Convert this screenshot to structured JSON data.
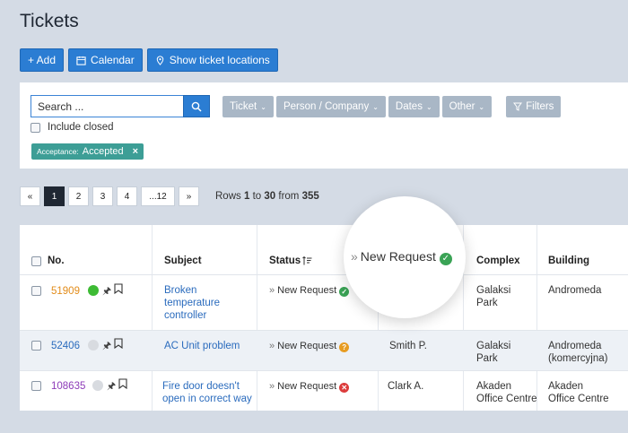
{
  "page": {
    "title": "Tickets"
  },
  "toolbar": {
    "add_label": "+ Add",
    "calendar_label": "Calendar",
    "locations_label": "Show ticket locations"
  },
  "filters": {
    "search_placeholder": "Search ...",
    "include_closed_label": "Include closed",
    "buttons": [
      "Ticket",
      "Person / Company",
      "Dates",
      "Other"
    ],
    "filters_label": "Filters",
    "tag_label": "Acceptance:",
    "tag_value": "Accepted",
    "tag_remove": "×"
  },
  "pagination": {
    "prev": "«",
    "pages": [
      "1",
      "2",
      "3",
      "4",
      "...12"
    ],
    "next": "»",
    "rows_prefix": "Rows",
    "rows_from": "1",
    "rows_to_word": "to",
    "rows_to": "30",
    "rows_from_word": "from",
    "rows_total": "355"
  },
  "table": {
    "headers": {
      "no": "No.",
      "subject": "Subject",
      "status": "Status",
      "complex": "Complex",
      "building": "Building"
    },
    "rows": [
      {
        "no": "51909",
        "no_color": "#e28c1a",
        "dot_color": "#3dbb34",
        "subject_line1": "Broken",
        "subject_line2": "temperature",
        "subject_line3": "controller",
        "status": "New Request",
        "status_icon": "check",
        "person": "",
        "complex_line1": "Galaksi",
        "complex_line2": "Park",
        "building_line1": "Andromeda",
        "building_line2": ""
      },
      {
        "no": "52406",
        "no_color": "#2a6bbd",
        "dot_color": "#d8dbe0",
        "subject_line1": "AC Unit problem",
        "subject_line2": "",
        "subject_line3": "",
        "status": "New Request",
        "status_icon": "question",
        "person": "Smith P.",
        "complex_line1": "Galaksi",
        "complex_line2": "Park",
        "building_line1": "Andromeda",
        "building_line2": "(komercyjna)"
      },
      {
        "no": "108635",
        "no_color": "#8d3bb8",
        "dot_color": "#d8dbe0",
        "subject_line1": "Fire door doesn't",
        "subject_line2": "open in correct way",
        "subject_line3": "",
        "status": "New Request",
        "status_icon": "cross",
        "person": "Clark A.",
        "complex_line1": "Akaden",
        "complex_line2": "Office Centre",
        "building_line1": "Akaden",
        "building_line2": "Office Centre"
      }
    ]
  },
  "magnifier": {
    "text": "New Request"
  },
  "colors": {
    "primary": "#2b7dd3",
    "tag": "#3d9e96",
    "ok": "#3aa355",
    "warn": "#e79c22",
    "error": "#dc3b3b"
  }
}
